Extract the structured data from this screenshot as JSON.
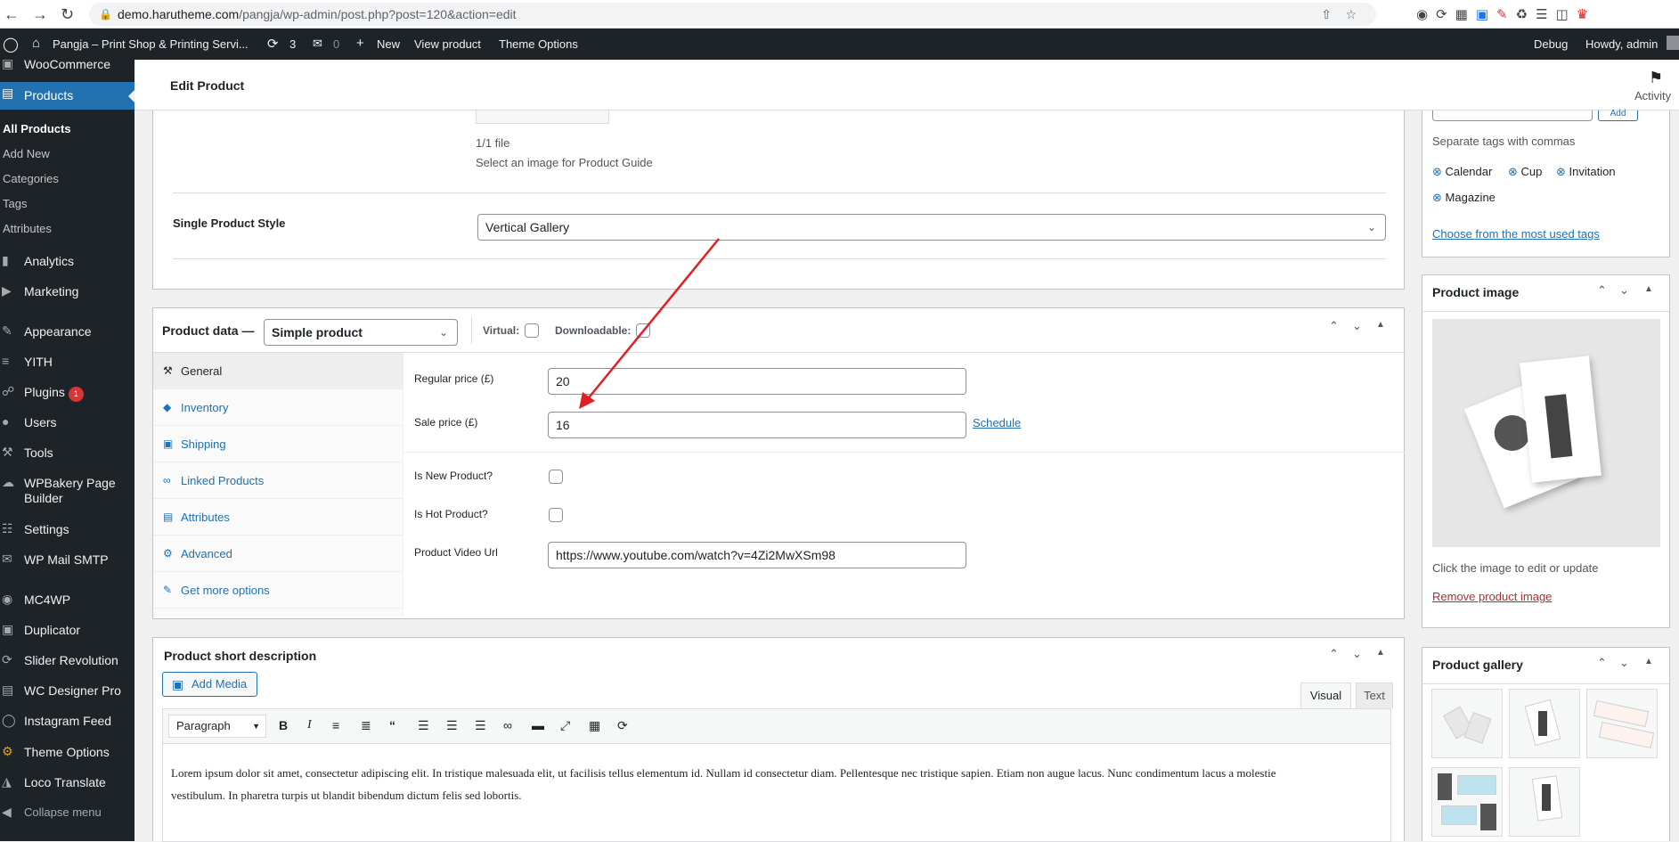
{
  "browser": {
    "url_host": "demo.harutheme.com",
    "url_path": "/pangja/wp-admin/post.php?post=120&action=edit",
    "toolbar_icons": [
      "wordpress-ext-icon",
      "sync-icon",
      "grid-icon",
      "bookmark-ext-icon",
      "brush-ext-icon",
      "puzzle-icon",
      "playlist-icon",
      "sidepanel-icon",
      "profile-ext-icon"
    ]
  },
  "adminbar": {
    "site_name": "Pangja – Print Shop & Printing Servi...",
    "updates": "3",
    "comments": "0",
    "new": "New",
    "view_product": "View product",
    "theme_options": "Theme Options",
    "debug": "Debug",
    "howdy": "Howdy, admin"
  },
  "sidebar": {
    "woocommerce": "WooCommerce",
    "products": "Products",
    "sub": [
      "All Products",
      "Add New",
      "Categories",
      "Tags",
      "Attributes"
    ],
    "items": [
      "Analytics",
      "Marketing",
      "Appearance",
      "YITH",
      "Plugins",
      "Users",
      "Tools",
      "WPBakery Page",
      "Builder",
      "Settings",
      "WP Mail SMTP",
      "MC4WP",
      "Duplicator",
      "Slider Revolution",
      "WC Designer Pro",
      "Instagram Feed",
      "Theme Options",
      "Loco Translate",
      "Collapse menu"
    ],
    "plugins_badge": "1"
  },
  "header": {
    "title": "Edit Product",
    "activity": "Activity"
  },
  "guide": {
    "count": "1/1 file",
    "hint": "Select an image for Product Guide",
    "style_label": "Single Product Style",
    "style_value": "Vertical Gallery"
  },
  "product_data": {
    "label": "Product data —",
    "type": "Simple product",
    "virtual": "Virtual:",
    "downloadable": "Downloadable:",
    "tabs": [
      "General",
      "Inventory",
      "Shipping",
      "Linked Products",
      "Attributes",
      "Advanced",
      "Get more options"
    ],
    "regular_price_label": "Regular price (£)",
    "regular_price": "20",
    "sale_price_label": "Sale price (£)",
    "sale_price": "16",
    "schedule": "Schedule",
    "is_new": "Is New Product?",
    "is_hot": "Is Hot Product?",
    "video_label": "Product Video Url",
    "video_url": "https://www.youtube.com/watch?v=4Zi2MwXSm98"
  },
  "short_desc": {
    "title": "Product short description",
    "add_media": "Add Media",
    "visual": "Visual",
    "text": "Text",
    "format": "Paragraph",
    "content_line1": "Lorem ipsum dolor sit amet, consectetur adipiscing elit. In tristique malesuada elit, ut facilisis tellus elementum id. Nullam id consectetur diam. Pellentesque nec tristique sapien. Etiam non augue lacus. Nunc condimentum lacus a molestie",
    "content_line2": "vestibulum. In pharetra turpis ut blandit bibendum dictum felis sed lobortis."
  },
  "tags_box": {
    "hint": "Separate tags with commas",
    "tags": [
      "Calendar",
      "Cup",
      "Invitation",
      "Magazine"
    ],
    "choose": "Choose from the most used tags",
    "add": "Add"
  },
  "product_image": {
    "title": "Product image",
    "hint": "Click the image to edit or update",
    "remove": "Remove product image"
  },
  "gallery": {
    "title": "Product gallery"
  },
  "annotation": {
    "color": "#e02020"
  }
}
